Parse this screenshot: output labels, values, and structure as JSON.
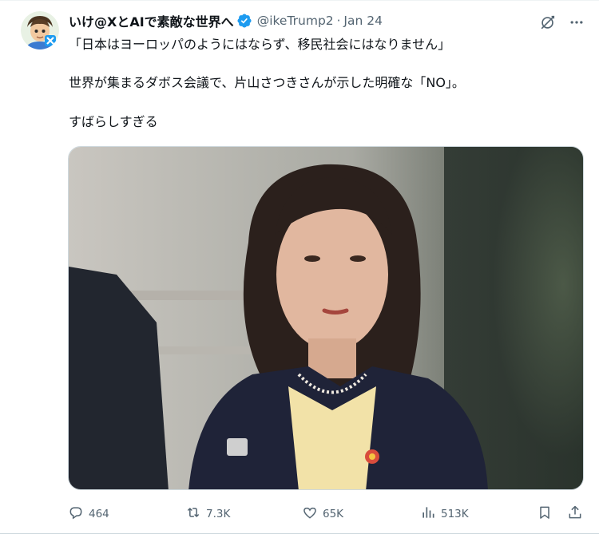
{
  "author": {
    "display_name": "いけ@XとAIで素敵な世界へ",
    "handle": "@ikeTrump2",
    "separator": "·",
    "date": "Jan 24",
    "verified": true
  },
  "tweet": {
    "lines": [
      "「日本はヨーロッパのようにはならず、移民社会にはなりません」",
      "世界が集まるダボス会議で、片山さつきさんが示した明確な「NO」。",
      "すばらしすぎる"
    ]
  },
  "actions": {
    "replies": "464",
    "reposts": "7.3K",
    "likes": "65K",
    "views": "513K"
  },
  "icons": {
    "verified": "verified-badge-icon",
    "grok": "grok-icon",
    "more": "more-icon",
    "reply": "reply-icon",
    "repost": "repost-icon",
    "like": "like-icon",
    "views": "views-icon",
    "bookmark": "bookmark-icon",
    "share": "share-icon"
  },
  "colors": {
    "text": "#0f1419",
    "secondary": "#536471",
    "verified": "#1d9bf0",
    "border": "#cfd9de"
  }
}
